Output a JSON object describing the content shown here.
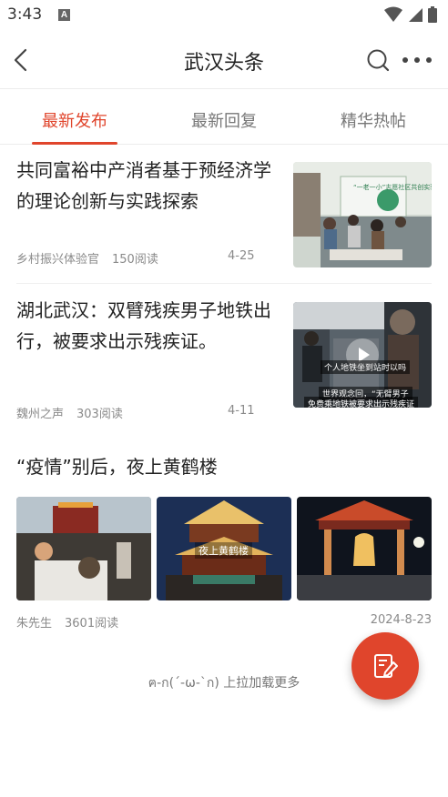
{
  "status_bar": {
    "time": "3:43",
    "notification_icon": "A"
  },
  "header": {
    "title": "武汉头条",
    "icons": [
      "back-arrow-icon",
      "search-icon",
      "more-icon"
    ]
  },
  "tabs": [
    {
      "label": "最新发布",
      "active": true
    },
    {
      "label": "最新回复",
      "active": false
    },
    {
      "label": "精华热帖",
      "active": false
    }
  ],
  "articles": [
    {
      "title": "共同富裕中产消者基于预经济学的理论创新与实践探索",
      "author": "乡村振兴体验官",
      "reads": "150阅读",
      "date": "4-25",
      "thumb_caption": "“一老一小”志愿社区共创实验"
    },
    {
      "title": "湖北武汉：双臂残疾男子地铁出行，被要求出示残疾证。",
      "author": "魏州之声",
      "reads": "303阅读",
      "date": "4-11",
      "thumb_caption_1": "个人地铁坐到站时以吗",
      "thumb_caption_2": "世界观念回，“无臂男子",
      "thumb_caption_3": "免费乘地铁被要求出示残疾证"
    },
    {
      "title": "“疫情”别后，夜上黄鹤楼",
      "author": "朱先生",
      "reads": "3601阅读",
      "date": "2024-8-23",
      "pic_caption": "夜上黄鹤楼"
    }
  ],
  "footer": {
    "load_more": "ฅ-ก(ˊ-ω-ˋก) 上拉加载更多"
  },
  "colors": {
    "accent": "#e0452c",
    "text": "#222222",
    "meta": "#8a8a8a"
  }
}
